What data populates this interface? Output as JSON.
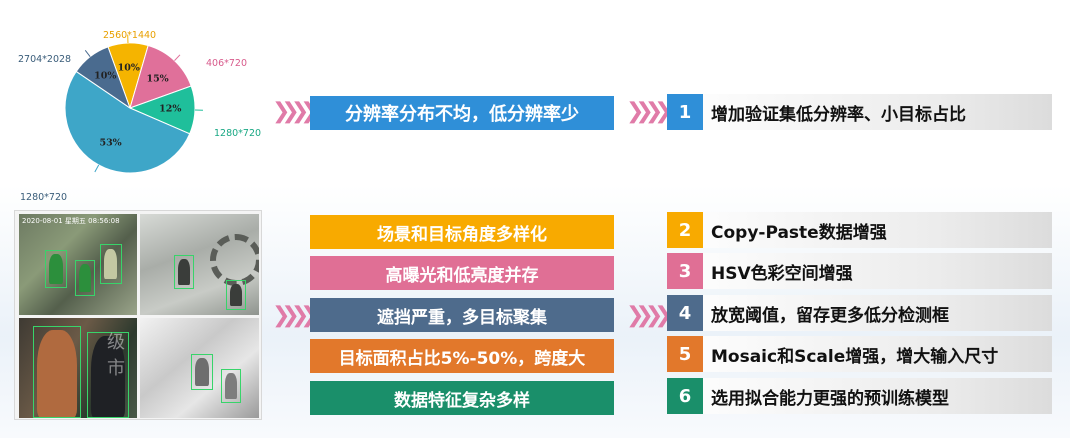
{
  "chart_data": {
    "type": "pie",
    "title": "",
    "slices": [
      {
        "label": "2560*1440",
        "value": 10,
        "pct_label": "10%",
        "color": "#f5b400"
      },
      {
        "label": "406*720",
        "value": 15,
        "pct_label": "15%",
        "color": "#e0709a"
      },
      {
        "label": "1280*720",
        "value": 12,
        "pct_label": "12%",
        "color": "#1fbf9b"
      },
      {
        "label": "1280*720",
        "value": 53,
        "pct_label": "53%",
        "color": "#3ea6c8"
      },
      {
        "label": "2704*2028",
        "value": 10,
        "pct_label": "10%",
        "color": "#4a6b8f"
      }
    ]
  },
  "top_issue": {
    "label": "分辨率分布不均，低分辨率少",
    "color": "#2f8fd8"
  },
  "issues": [
    {
      "label": "场景和目标角度多样化",
      "color": "#f8aa00"
    },
    {
      "label": "高曝光和低亮度并存",
      "color": "#e06f95"
    },
    {
      "label": "遮挡严重，多目标聚集",
      "color": "#4e6b8c"
    },
    {
      "label": "目标面积占比5%-50%，跨度大",
      "color": "#e2782b"
    },
    {
      "label": "数据特征复杂多样",
      "color": "#1a8f6a"
    }
  ],
  "methods": [
    {
      "num": "1",
      "label": "增加验证集低分辨率、小目标占比",
      "color": "#2f8fd8"
    },
    {
      "num": "2",
      "label": "Copy-Paste数据增强",
      "color": "#f8aa00"
    },
    {
      "num": "3",
      "label": "HSV色彩空间增强",
      "color": "#e06f95"
    },
    {
      "num": "4",
      "label": "放宽阈值，留存更多低分检测框",
      "color": "#4e6b8c"
    },
    {
      "num": "5",
      "label": "Mosaic和Scale增强，增大输入尺寸",
      "color": "#e2782b"
    },
    {
      "num": "6",
      "label": "选用拟合能力更强的预训练模型",
      "color": "#1a8f6a"
    }
  ],
  "photo_overlay": {
    "timestamp": "2020-08-01  星期五  08:56:08",
    "watermark": "级市"
  },
  "arrow_glyph": "❯❯❯❯"
}
